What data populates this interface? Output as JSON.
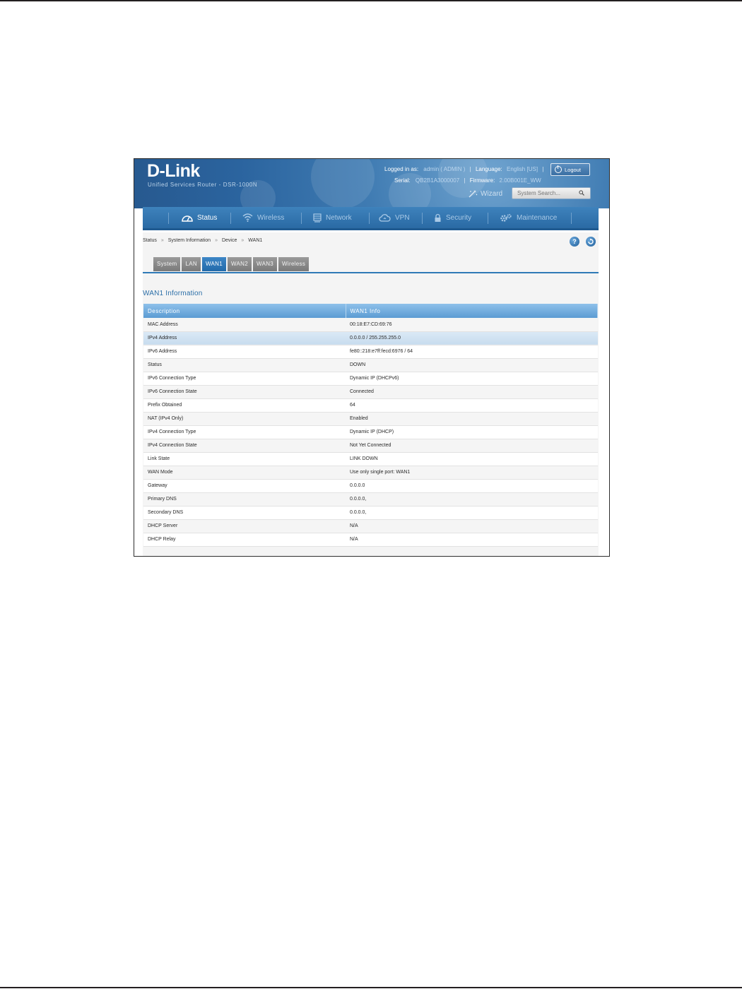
{
  "header": {
    "brand": "D-Link",
    "product": "Unified Services Router - DSR-1000N",
    "logged_in_label": "Logged in as:",
    "logged_in_value": "admin ( ADMIN )",
    "language_label": "Language:",
    "language_value": "English [US]",
    "serial_label": "Serial:",
    "serial_value": "QB2B1A3000007",
    "firmware_label": "Firmware:",
    "firmware_value": "2.00B001E_WW",
    "logout_label": "Logout",
    "wizard_label": "Wizard",
    "search_placeholder": "System Search..."
  },
  "nav": {
    "items": [
      {
        "label": "Status",
        "icon": "dashboard-icon"
      },
      {
        "label": "Wireless",
        "icon": "wifi-icon"
      },
      {
        "label": "Network",
        "icon": "server-icon"
      },
      {
        "label": "VPN",
        "icon": "cloud-icon"
      },
      {
        "label": "Security",
        "icon": "lock-icon"
      },
      {
        "label": "Maintenance",
        "icon": "gears-icon"
      }
    ],
    "active": "Status"
  },
  "breadcrumb": [
    "Status",
    "System Information",
    "Device",
    "WAN1"
  ],
  "tabs": [
    "System",
    "LAN",
    "WAN1",
    "WAN2",
    "WAN3",
    "Wireless"
  ],
  "active_tab": "WAN1",
  "section_title": "WAN1 Information",
  "table": {
    "headers": [
      "Description",
      "WAN1 Info"
    ],
    "rows": [
      [
        "MAC Address",
        "00:18:E7:CD:69:76"
      ],
      [
        "IPv4 Address",
        "0.0.0.0 / 255.255.255.0"
      ],
      [
        "IPv6 Address",
        "fe80::218:e7ff:fecd:6976 / 64"
      ],
      [
        "Status",
        "DOWN"
      ],
      [
        "IPv6 Connection Type",
        "Dynamic IP (DHCPv6)"
      ],
      [
        "IPv6 Connection State",
        "Connected"
      ],
      [
        "Prefix Obtained",
        "64"
      ],
      [
        "NAT (IPv4 Only)",
        "Enabled"
      ],
      [
        "IPv4 Connection Type",
        "Dynamic IP (DHCP)"
      ],
      [
        "IPv4 Connection State",
        "Not Yet Connected"
      ],
      [
        "Link State",
        "LINK DOWN"
      ],
      [
        "WAN Mode",
        "Use only single port: WAN1"
      ],
      [
        "Gateway",
        "0.0.0.0"
      ],
      [
        "Primary DNS",
        "0.0.0.0,"
      ],
      [
        "Secondary DNS",
        "0.0.0.0,"
      ],
      [
        "DHCP Server",
        "N/A"
      ],
      [
        "DHCP Relay",
        "N/A"
      ]
    ]
  }
}
